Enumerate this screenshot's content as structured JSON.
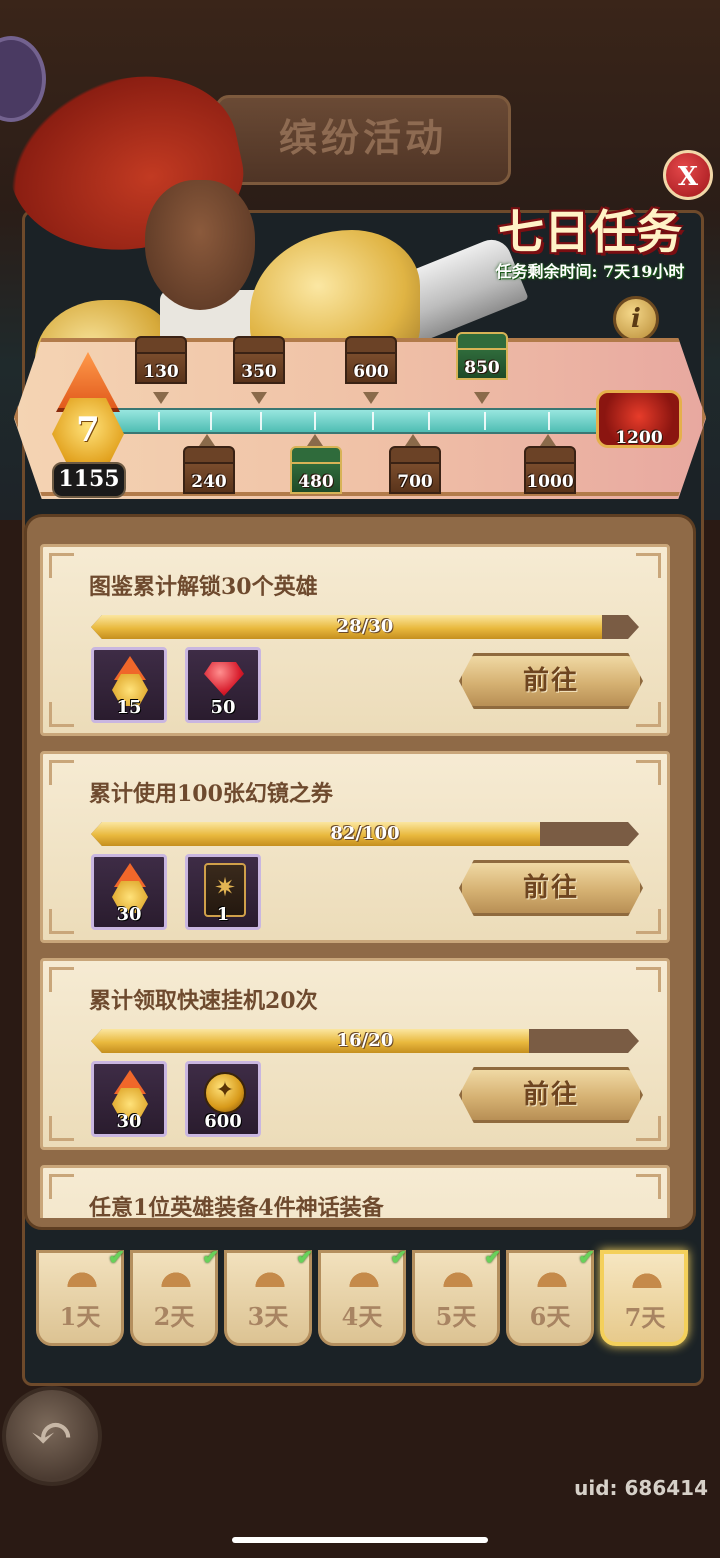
{
  "header": {
    "title": "缤纷活动"
  },
  "event": {
    "title": "七日任务",
    "remaining_time": "任务剩余时间: 7天19小时",
    "close_label": "X",
    "info_label": "i"
  },
  "milestones": {
    "level": "7",
    "points": "1155",
    "top_chests": [
      "130",
      "350",
      "600",
      "850"
    ],
    "bottom_chests": [
      "240",
      "480",
      "700",
      "1000"
    ],
    "final_chest": "1200"
  },
  "tasks": [
    {
      "title": "图鉴累计解锁30个英雄",
      "progress_text": "28/30",
      "progress": 0.933,
      "rewards": [
        {
          "icon": "activity-point-badge-icon",
          "count": "15"
        },
        {
          "icon": "red-gem-icon",
          "count": "50"
        }
      ],
      "button": "前往"
    },
    {
      "title": "累计使用100张幻镜之券",
      "progress_text": "82/100",
      "progress": 0.82,
      "rewards": [
        {
          "icon": "activity-point-badge-icon",
          "count": "30"
        },
        {
          "icon": "mirror-ticket-card-icon",
          "count": "1"
        }
      ],
      "button": "前往"
    },
    {
      "title": "累计领取快速挂机20次",
      "progress_text": "16/20",
      "progress": 0.8,
      "rewards": [
        {
          "icon": "activity-point-badge-icon",
          "count": "30"
        },
        {
          "icon": "gold-coin-icon",
          "count": "600"
        }
      ],
      "button": "前往"
    },
    {
      "title": "任意1位英雄装备4件神话装备"
    }
  ],
  "days": [
    {
      "label": "1天",
      "done": true
    },
    {
      "label": "2天",
      "done": true
    },
    {
      "label": "3天",
      "done": true
    },
    {
      "label": "4天",
      "done": true
    },
    {
      "label": "5天",
      "done": true
    },
    {
      "label": "6天",
      "done": true
    },
    {
      "label": "7天",
      "done": false,
      "active": true
    }
  ],
  "footer": {
    "uid": "uid: 686414"
  },
  "colors": {
    "accent_gold": "#e9b93e",
    "track_teal": "#4fbdb3",
    "title_red": "#7a0e12"
  }
}
